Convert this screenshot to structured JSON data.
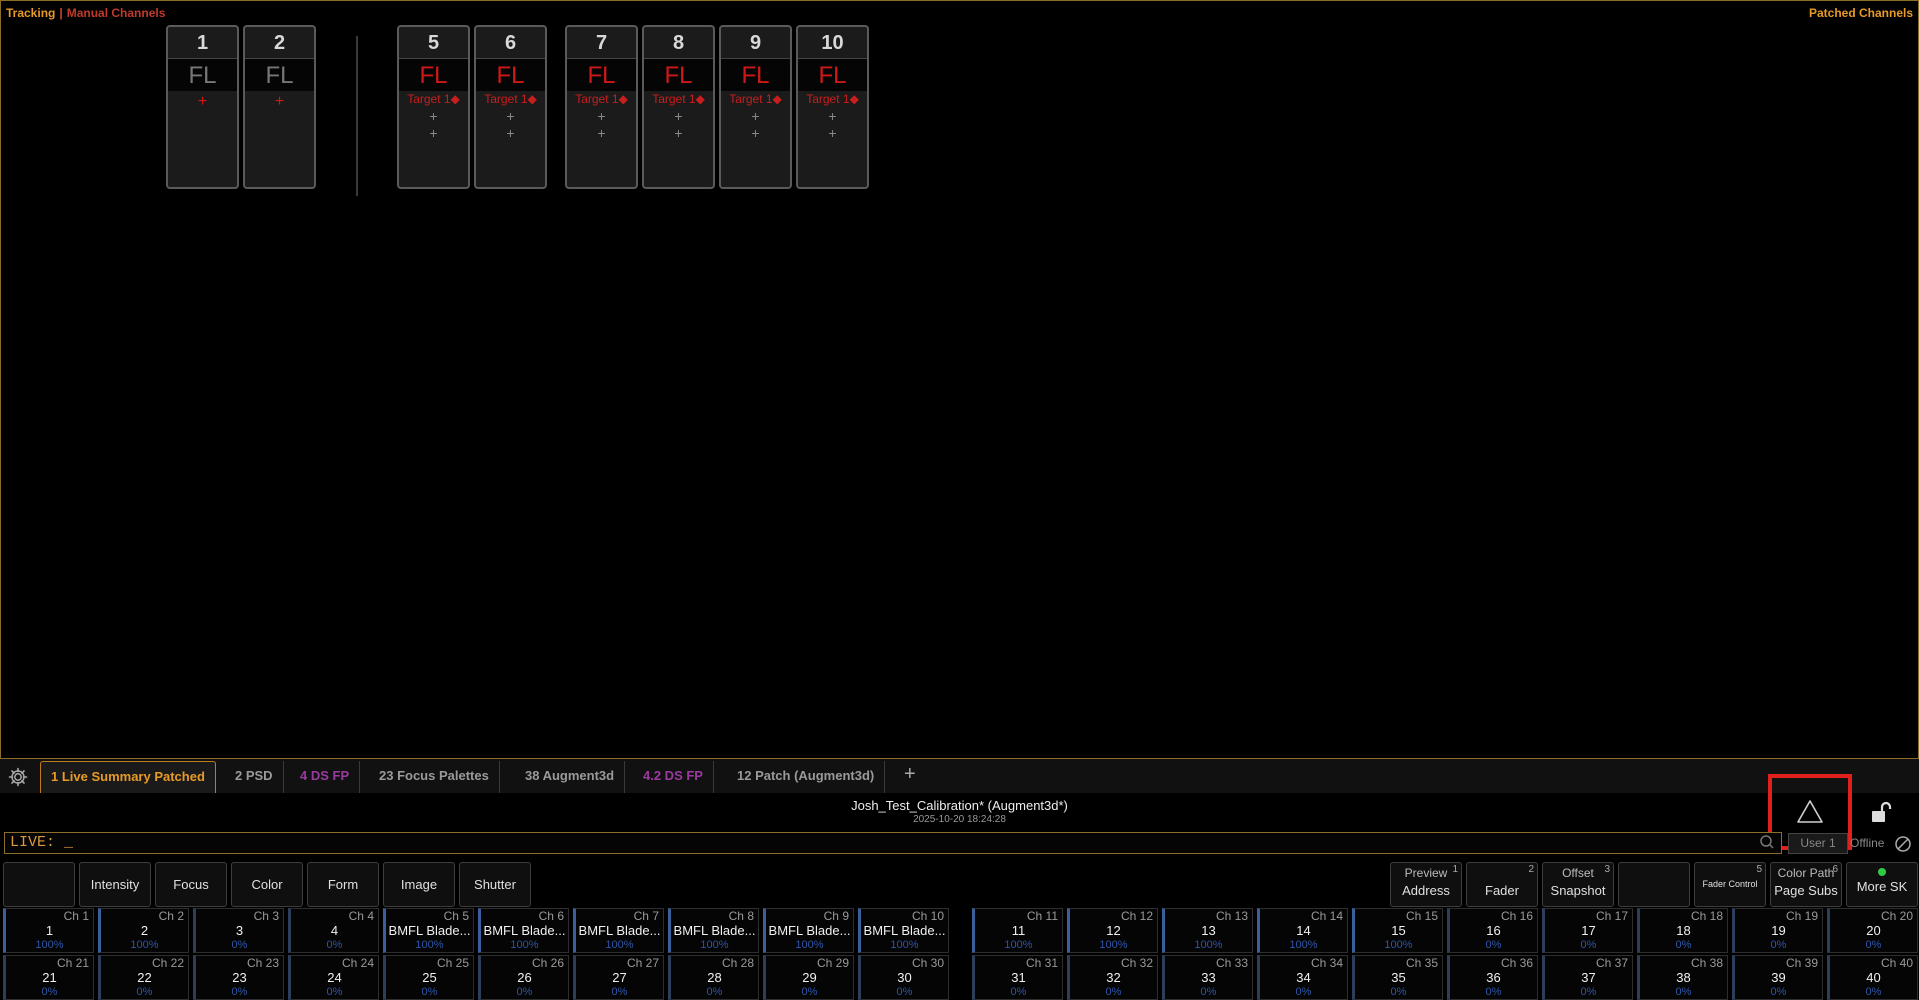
{
  "header": {
    "mode": "Tracking",
    "separator": "|",
    "view": "Manual Channels",
    "right_title": "Patched Channels"
  },
  "channels": [
    {
      "num": "1",
      "label": "FL",
      "style": "gray",
      "lines": [
        {
          "text": "+",
          "kind": "plusred"
        }
      ]
    },
    {
      "num": "2",
      "label": "FL",
      "style": "gray",
      "lines": [
        {
          "text": "+",
          "kind": "plusred"
        }
      ]
    },
    {
      "num": "5",
      "label": "FL",
      "style": "red",
      "lines": [
        {
          "text": "Target 1◆",
          "kind": "target"
        },
        {
          "text": "+",
          "kind": "plus"
        },
        {
          "text": "+",
          "kind": "plus"
        }
      ]
    },
    {
      "num": "6",
      "label": "FL",
      "style": "red",
      "lines": [
        {
          "text": "Target 1◆",
          "kind": "target"
        },
        {
          "text": "+",
          "kind": "plus"
        },
        {
          "text": "+",
          "kind": "plus"
        }
      ]
    },
    {
      "num": "7",
      "label": "FL",
      "style": "red",
      "lines": [
        {
          "text": "Target 1◆",
          "kind": "target"
        },
        {
          "text": "+",
          "kind": "plus"
        },
        {
          "text": "+",
          "kind": "plus"
        }
      ]
    },
    {
      "num": "8",
      "label": "FL",
      "style": "red",
      "lines": [
        {
          "text": "Target 1◆",
          "kind": "target"
        },
        {
          "text": "+",
          "kind": "plus"
        },
        {
          "text": "+",
          "kind": "plus"
        }
      ]
    },
    {
      "num": "9",
      "label": "FL",
      "style": "red",
      "lines": [
        {
          "text": "Target 1◆",
          "kind": "target"
        },
        {
          "text": "+",
          "kind": "plus"
        },
        {
          "text": "+",
          "kind": "plus"
        }
      ]
    },
    {
      "num": "10",
      "label": "FL",
      "style": "red",
      "lines": [
        {
          "text": "Target 1◆",
          "kind": "target"
        },
        {
          "text": "+",
          "kind": "plus"
        },
        {
          "text": "+",
          "kind": "plus"
        }
      ]
    }
  ],
  "tabs": [
    {
      "label": "1 Live Summary Patched",
      "state": "active"
    },
    {
      "label": "2 PSD",
      "state": "normal"
    },
    {
      "label": "4 DS  FP",
      "state": "purple"
    },
    {
      "label": "23 Focus Palettes",
      "state": "normal"
    },
    {
      "label": "38 Augment3d",
      "state": "normal"
    },
    {
      "label": "4.2 DS  FP",
      "state": "purple"
    },
    {
      "label": "12 Patch (Augment3d)",
      "state": "normal"
    }
  ],
  "tab_add": "+",
  "showfile": {
    "name": "Josh_Test_Calibration* (Augment3d*)",
    "datetime": "2025-10-20 18:24:28"
  },
  "command_line": {
    "text": "LIVE:  _"
  },
  "user": {
    "label": "User 1",
    "status": "Offline"
  },
  "softkeys_left": [
    {
      "label": ""
    },
    {
      "label": "Intensity"
    },
    {
      "label": "Focus"
    },
    {
      "label": "Color"
    },
    {
      "label": "Form"
    },
    {
      "label": "Image"
    },
    {
      "label": "Shutter"
    }
  ],
  "softkeys_right": [
    {
      "top": "Preview",
      "bottom": "Address",
      "num": "1"
    },
    {
      "top": "",
      "bottom": "Fader",
      "num": "2"
    },
    {
      "top": "Offset",
      "bottom": "Snapshot",
      "num": "3"
    },
    {
      "top": "",
      "bottom": "",
      "num": ""
    },
    {
      "top": "",
      "bottom": "Fader Control",
      "num": "5",
      "tiny": true
    },
    {
      "top": "Color Path",
      "bottom": "Page Subs",
      "num": "6"
    },
    {
      "top": "",
      "bottom": "More SK",
      "num": "",
      "dot": true
    }
  ],
  "faders_row1": [
    {
      "ch": "Ch 1",
      "name": "1",
      "pct": "100%",
      "sel": true
    },
    {
      "ch": "Ch 2",
      "name": "2",
      "pct": "100%",
      "sel": true
    },
    {
      "ch": "Ch 3",
      "name": "3",
      "pct": "0%",
      "sel": false
    },
    {
      "ch": "Ch 4",
      "name": "4",
      "pct": "0%",
      "sel": false
    },
    {
      "ch": "Ch 5",
      "name": "BMFL Blade...",
      "pct": "100%",
      "sel": true
    },
    {
      "ch": "Ch 6",
      "name": "BMFL Blade...",
      "pct": "100%",
      "sel": true
    },
    {
      "ch": "Ch 7",
      "name": "BMFL Blade...",
      "pct": "100%",
      "sel": true
    },
    {
      "ch": "Ch 8",
      "name": "BMFL Blade...",
      "pct": "100%",
      "sel": true
    },
    {
      "ch": "Ch 9",
      "name": "BMFL Blade...",
      "pct": "100%",
      "sel": true
    },
    {
      "ch": "Ch 10",
      "name": "BMFL Blade...",
      "pct": "100%",
      "sel": true
    },
    {
      "ch": "Ch 11",
      "name": "11",
      "pct": "100%",
      "sel": true
    },
    {
      "ch": "Ch 12",
      "name": "12",
      "pct": "100%",
      "sel": true
    },
    {
      "ch": "Ch 13",
      "name": "13",
      "pct": "100%",
      "sel": true
    },
    {
      "ch": "Ch 14",
      "name": "14",
      "pct": "100%",
      "sel": true
    },
    {
      "ch": "Ch 15",
      "name": "15",
      "pct": "100%",
      "sel": true
    },
    {
      "ch": "Ch 16",
      "name": "16",
      "pct": "0%",
      "sel": false
    },
    {
      "ch": "Ch 17",
      "name": "17",
      "pct": "0%",
      "sel": false
    },
    {
      "ch": "Ch 18",
      "name": "18",
      "pct": "0%",
      "sel": false
    },
    {
      "ch": "Ch 19",
      "name": "19",
      "pct": "0%",
      "sel": false
    },
    {
      "ch": "Ch 20",
      "name": "20",
      "pct": "0%",
      "sel": false
    }
  ],
  "faders_row2": [
    {
      "ch": "Ch 21",
      "name": "21",
      "pct": "0%"
    },
    {
      "ch": "Ch 22",
      "name": "22",
      "pct": "0%"
    },
    {
      "ch": "Ch 23",
      "name": "23",
      "pct": "0%"
    },
    {
      "ch": "Ch 24",
      "name": "24",
      "pct": "0%"
    },
    {
      "ch": "Ch 25",
      "name": "25",
      "pct": "0%"
    },
    {
      "ch": "Ch 26",
      "name": "26",
      "pct": "0%"
    },
    {
      "ch": "Ch 27",
      "name": "27",
      "pct": "0%"
    },
    {
      "ch": "Ch 28",
      "name": "28",
      "pct": "0%"
    },
    {
      "ch": "Ch 29",
      "name": "29",
      "pct": "0%"
    },
    {
      "ch": "Ch 30",
      "name": "30",
      "pct": "0%"
    },
    {
      "ch": "Ch 31",
      "name": "31",
      "pct": "0%"
    },
    {
      "ch": "Ch 32",
      "name": "32",
      "pct": "0%"
    },
    {
      "ch": "Ch 33",
      "name": "33",
      "pct": "0%"
    },
    {
      "ch": "Ch 34",
      "name": "34",
      "pct": "0%"
    },
    {
      "ch": "Ch 35",
      "name": "35",
      "pct": "0%"
    },
    {
      "ch": "Ch 36",
      "name": "36",
      "pct": "0%"
    },
    {
      "ch": "Ch 37",
      "name": "37",
      "pct": "0%"
    },
    {
      "ch": "Ch 38",
      "name": "38",
      "pct": "0%"
    },
    {
      "ch": "Ch 39",
      "name": "39",
      "pct": "0%"
    },
    {
      "ch": "Ch 40",
      "name": "40",
      "pct": "0%"
    }
  ],
  "colors": {
    "accent": "#e89a27",
    "alert": "#e0201a",
    "fl_red": "#d01818",
    "percent_blue": "#2f56a8"
  }
}
